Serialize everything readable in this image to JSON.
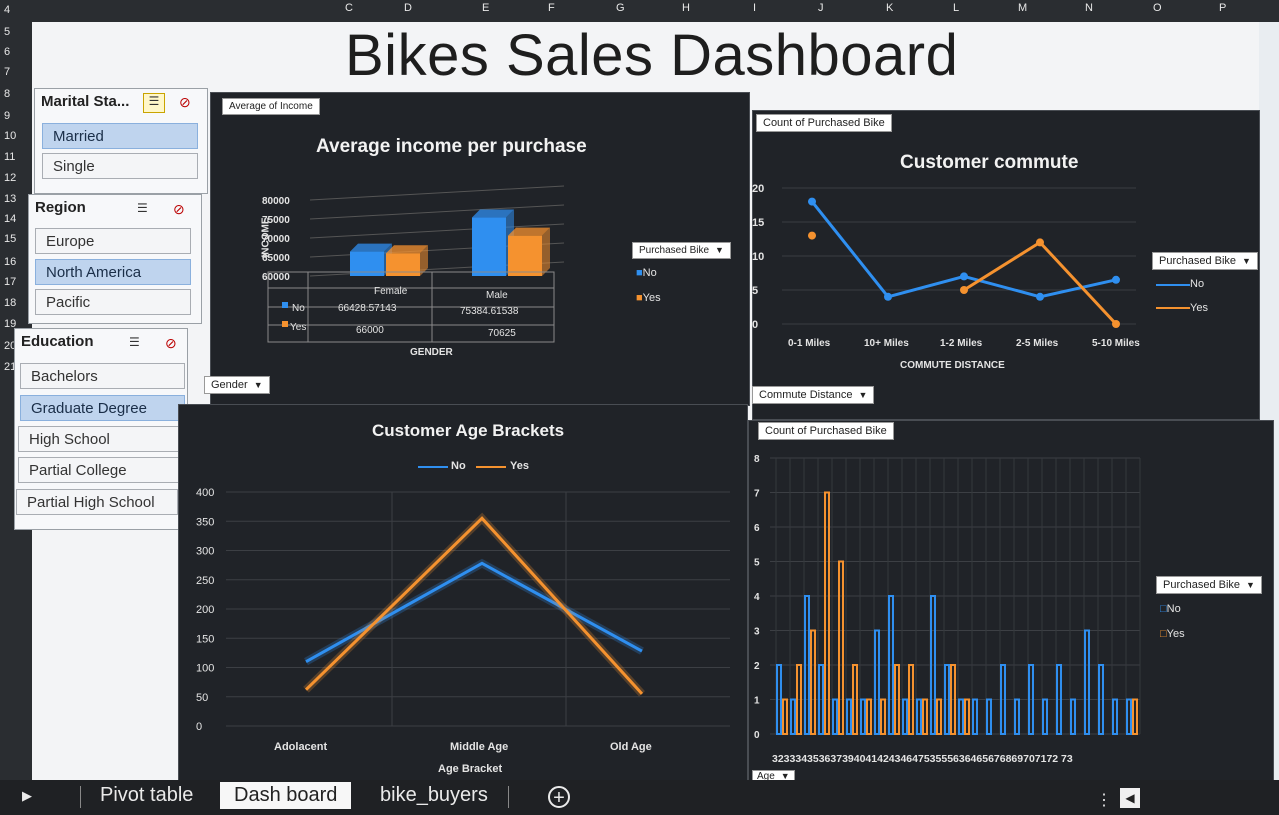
{
  "title": "Bikes Sales Dashboard",
  "column_headers": [
    "C",
    "D",
    "E",
    "F",
    "G",
    "H",
    "I",
    "J",
    "K",
    "L",
    "M",
    "N",
    "O",
    "P"
  ],
  "row_headers": [
    "4",
    "5",
    "6",
    "7",
    "8",
    "9",
    "10",
    "11",
    "12",
    "13",
    "14",
    "15",
    "16",
    "17",
    "18",
    "19",
    "20",
    "21"
  ],
  "slicers": {
    "marital": {
      "header": "Marital Sta...",
      "items": [
        {
          "label": "Married",
          "selected": true
        },
        {
          "label": "Single",
          "selected": false
        }
      ]
    },
    "region": {
      "header": "Region",
      "items": [
        {
          "label": "Europe",
          "selected": false
        },
        {
          "label": "North America",
          "selected": true
        },
        {
          "label": "Pacific",
          "selected": false
        }
      ]
    },
    "education": {
      "header": "Education",
      "items": [
        {
          "label": "Bachelors",
          "selected": false
        },
        {
          "label": "Graduate Degree",
          "selected": true
        },
        {
          "label": "High School",
          "selected": false
        },
        {
          "label": "Partial College",
          "selected": false
        },
        {
          "label": "Partial High School",
          "selected": false
        }
      ]
    }
  },
  "filter_buttons": {
    "income_value": "Average of Income",
    "gender": "Gender",
    "commute_value": "Count of Purchased Bike",
    "commute_legend": "Purchased Bike",
    "commute_axis": "Commute Distance",
    "age_value": "Count of Purchased Bike",
    "age_legend": "Purchased Bike",
    "age_axis": "Age"
  },
  "colors": {
    "no": "#2f8ff0",
    "yes": "#f5922f",
    "panel": "#202328"
  },
  "sheet_tabs": [
    "Pivot table",
    "Dash board",
    "bike_buyers"
  ],
  "active_tab": "Dash board",
  "chart_data": [
    {
      "type": "bar",
      "title": "Average income per purchase",
      "xlabel": "GENDER",
      "ylabel": "INCOME",
      "categories": [
        "Female",
        "Male"
      ],
      "series": [
        {
          "name": "No",
          "values": [
            66428.57143,
            75384.61538
          ],
          "labels": [
            "66428.57143",
            "75384.61538"
          ]
        },
        {
          "name": "Yes",
          "values": [
            66000,
            70625
          ],
          "labels": [
            "66000",
            "70625"
          ]
        }
      ],
      "yticks": [
        "80000",
        "75000",
        "70000",
        "65000",
        "60000"
      ],
      "ylim": [
        60000,
        80000
      ],
      "legend_title": "Purchased Bike",
      "legend": [
        "No",
        "Yes"
      ]
    },
    {
      "type": "line",
      "title": "Customer commute",
      "xlabel": "COMMUTE DISTANCE",
      "categories": [
        "0-1 Miles",
        "10+ Miles",
        "1-2 Miles",
        "2-5 Miles",
        "5-10 Miles"
      ],
      "series": [
        {
          "name": "No",
          "values": [
            18,
            4,
            7,
            4,
            6.5
          ]
        },
        {
          "name": "Yes",
          "values": [
            13,
            null,
            5,
            12,
            0
          ]
        }
      ],
      "yticks": [
        "20",
        "15",
        "10",
        "5",
        "0"
      ],
      "ylim": [
        0,
        20
      ],
      "legend_title": "Purchased Bike",
      "legend": [
        "No",
        "Yes"
      ]
    },
    {
      "type": "line",
      "title": "Customer Age Brackets",
      "xlabel": "Age Bracket",
      "categories": [
        "Adolacent",
        "Middle Age",
        "Old Age"
      ],
      "series": [
        {
          "name": "No",
          "values": [
            110,
            278,
            128
          ]
        },
        {
          "name": "Yes",
          "values": [
            62,
            355,
            55
          ]
        }
      ],
      "yticks": [
        "400",
        "350",
        "300",
        "250",
        "200",
        "150",
        "100",
        "50",
        "0"
      ],
      "ylim": [
        0,
        400
      ],
      "legend": [
        "No",
        "Yes"
      ]
    },
    {
      "type": "bar",
      "title": "",
      "x_label_string": "3233343536373940414243464753555636465676869707172 73",
      "categories": [
        "32",
        "33",
        "34",
        "35",
        "36",
        "37",
        "39",
        "40",
        "41",
        "42",
        "43",
        "46",
        "47",
        "53",
        "55",
        "56",
        "63",
        "64",
        "65",
        "67",
        "68",
        "69",
        "70",
        "71",
        "72",
        "73"
      ],
      "series": [
        {
          "name": "No",
          "values": [
            2,
            1,
            4,
            2,
            1,
            1,
            1,
            3,
            4,
            1,
            1,
            4,
            2,
            1,
            1,
            1,
            2,
            1,
            2,
            1,
            2,
            1,
            3,
            2,
            1,
            1
          ]
        },
        {
          "name": "Yes",
          "values": [
            1,
            2,
            3,
            7,
            5,
            2,
            1,
            1,
            2,
            2,
            1,
            1,
            2,
            1,
            0,
            0,
            0,
            0,
            0,
            0,
            0,
            0,
            0,
            0,
            0,
            1
          ]
        }
      ],
      "yticks": [
        "8",
        "7",
        "6",
        "5",
        "4",
        "3",
        "2",
        "1",
        "0"
      ],
      "ylim": [
        0,
        8
      ],
      "legend_title": "Purchased Bike",
      "legend": [
        "No",
        "Yes"
      ]
    }
  ]
}
